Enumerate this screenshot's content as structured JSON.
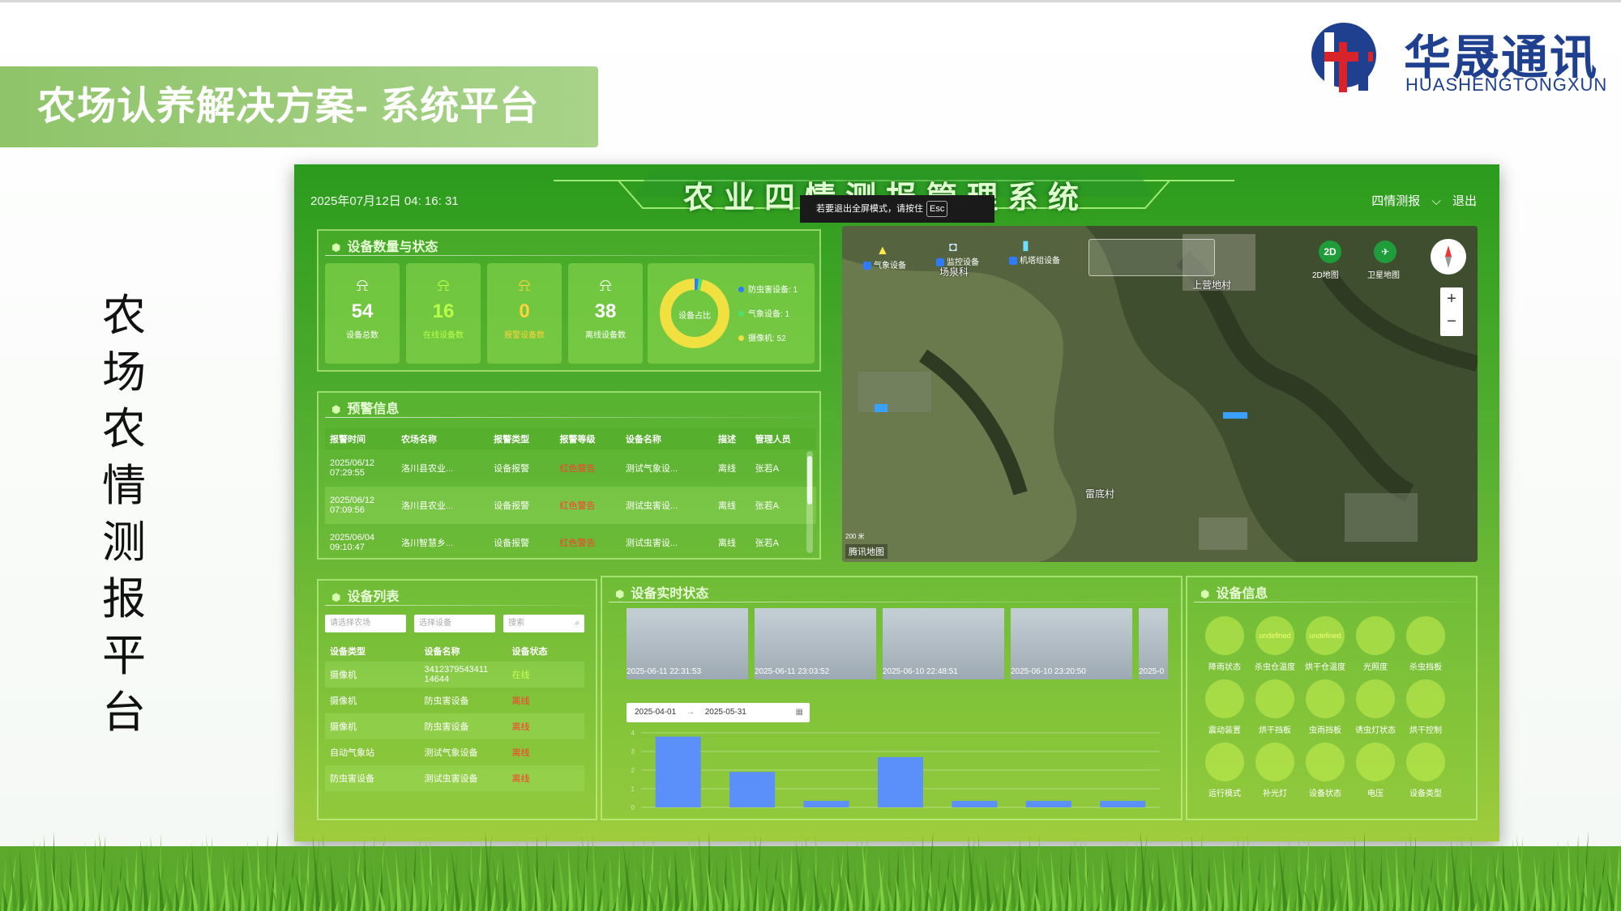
{
  "slide": {
    "title": "农场认养解决方案- 系统平台",
    "vertical_title": [
      "农",
      "场",
      "农",
      "情",
      "测",
      "报",
      "平",
      "台"
    ],
    "logo_cn": "华晟通讯",
    "logo_en": "HUASHENGTONGXUN"
  },
  "dashboard": {
    "datetime": "2025年07月12日 04: 16: 31",
    "title": "农业四情测报管理系统",
    "nav_menu": "四情测报",
    "logout": "退出",
    "fullscreen_tip": "若要退出全屏模式，请按住",
    "fullscreen_key": "Esc"
  },
  "device_count": {
    "title": "设备数量与状态",
    "stats": [
      {
        "value": "54",
        "label": "设备总数",
        "color": "#ffffff"
      },
      {
        "value": "16",
        "label": "在线设备数",
        "color": "#b8ff4a"
      },
      {
        "value": "0",
        "label": "报警设备数",
        "color": "#ffd23c"
      },
      {
        "value": "38",
        "label": "离线设备数",
        "color": "#ffffff"
      }
    ],
    "donut_label": "设备占比",
    "legend": [
      {
        "label": "防虫害设备: 1",
        "color": "#2e7bff"
      },
      {
        "label": "气象设备: 1",
        "color": "#4fe06a"
      },
      {
        "label": "摄像机: 52",
        "color": "#f0e040"
      }
    ],
    "donut_values": [
      1,
      1,
      52
    ]
  },
  "alarm": {
    "title": "预警信息",
    "columns": [
      "报警时间",
      "农场名称",
      "报警类型",
      "报警等级",
      "设备名称",
      "描述",
      "管理人员"
    ],
    "rows": [
      {
        "time": "2025/06/12 07:29:55",
        "farm": "洛川县农业...",
        "type": "设备报警",
        "level": "红色警告",
        "device": "测试气象设...",
        "desc": "离线",
        "manager": "张若A"
      },
      {
        "time": "2025/06/12 07:09:56",
        "farm": "洛川县农业...",
        "type": "设备报警",
        "level": "红色警告",
        "device": "测试虫害设...",
        "desc": "离线",
        "manager": "张若A"
      },
      {
        "time": "2025/06/04 09:10:47",
        "farm": "洛川智慧乡...",
        "type": "设备报警",
        "level": "红色警告",
        "device": "测试虫害设...",
        "desc": "离线",
        "manager": "张若A"
      }
    ]
  },
  "map": {
    "layers": [
      "气象设备",
      "监控设备",
      "机塔组设备"
    ],
    "btn_2d": "2D",
    "label_2d": "2D地图",
    "label_sat": "卫星地图",
    "zoom_in": "+",
    "zoom_out": "−",
    "labels": [
      "场泉科",
      "上营地村",
      "雷底村"
    ],
    "logo": "腾讯地图",
    "scale": "200 米"
  },
  "device_list": {
    "title": "设备列表",
    "filter_farm": "请选择农场",
    "filter_device": "选择设备",
    "search": "搜索",
    "columns": [
      "设备类型",
      "设备名称",
      "设备状态"
    ],
    "rows": [
      {
        "type": "摄像机",
        "name": "3412379543411 14644",
        "status": "在线"
      },
      {
        "type": "摄像机",
        "name": "防虫害设备",
        "status": "离线"
      },
      {
        "type": "摄像机",
        "name": "防虫害设备",
        "status": "离线"
      },
      {
        "type": "自动气象站",
        "name": "测试气象设备",
        "status": "离线"
      },
      {
        "type": "防虫害设备",
        "name": "测试虫害设备",
        "status": "离线"
      }
    ]
  },
  "realtime": {
    "title": "设备实时状态",
    "snapshots": [
      "2025-06-11 22:31:53",
      "2025-06-11 23:03:52",
      "2025-06-10 22:48:51",
      "2025-06-10 23:20:50",
      "2025-0"
    ],
    "date_start": "2025-04-01",
    "date_end": "2025-05-31",
    "arrow": "→",
    "chart_data": {
      "type": "bar",
      "categories": [
        "",
        "",
        "",
        "",
        "",
        "",
        ""
      ],
      "values": [
        3.8,
        1.9,
        0.35,
        2.7,
        0.35,
        0.35,
        0.35
      ],
      "ylim": [
        0,
        4
      ],
      "yticks": [
        "0",
        "1",
        "2",
        "3",
        "4"
      ],
      "color": "#5b8ff9"
    }
  },
  "device_info": {
    "title": "设备信息",
    "items": [
      {
        "value": "",
        "label": "降雨状态"
      },
      {
        "value": "undefined",
        "label": "杀虫仓温度"
      },
      {
        "value": "undefined",
        "label": "烘干仓温度"
      },
      {
        "value": "",
        "label": "光照度"
      },
      {
        "value": "",
        "label": "杀虫挡板"
      },
      {
        "value": "",
        "label": "震动装置"
      },
      {
        "value": "",
        "label": "烘干挡板"
      },
      {
        "value": "",
        "label": "虫雨挡板"
      },
      {
        "value": "",
        "label": "诱虫灯状态"
      },
      {
        "value": "",
        "label": "烘干控制"
      },
      {
        "value": "",
        "label": "运行模式"
      },
      {
        "value": "",
        "label": "补光灯"
      },
      {
        "value": "",
        "label": "设备状态"
      },
      {
        "value": "",
        "label": "电压"
      },
      {
        "value": "",
        "label": "设备类型"
      }
    ]
  }
}
